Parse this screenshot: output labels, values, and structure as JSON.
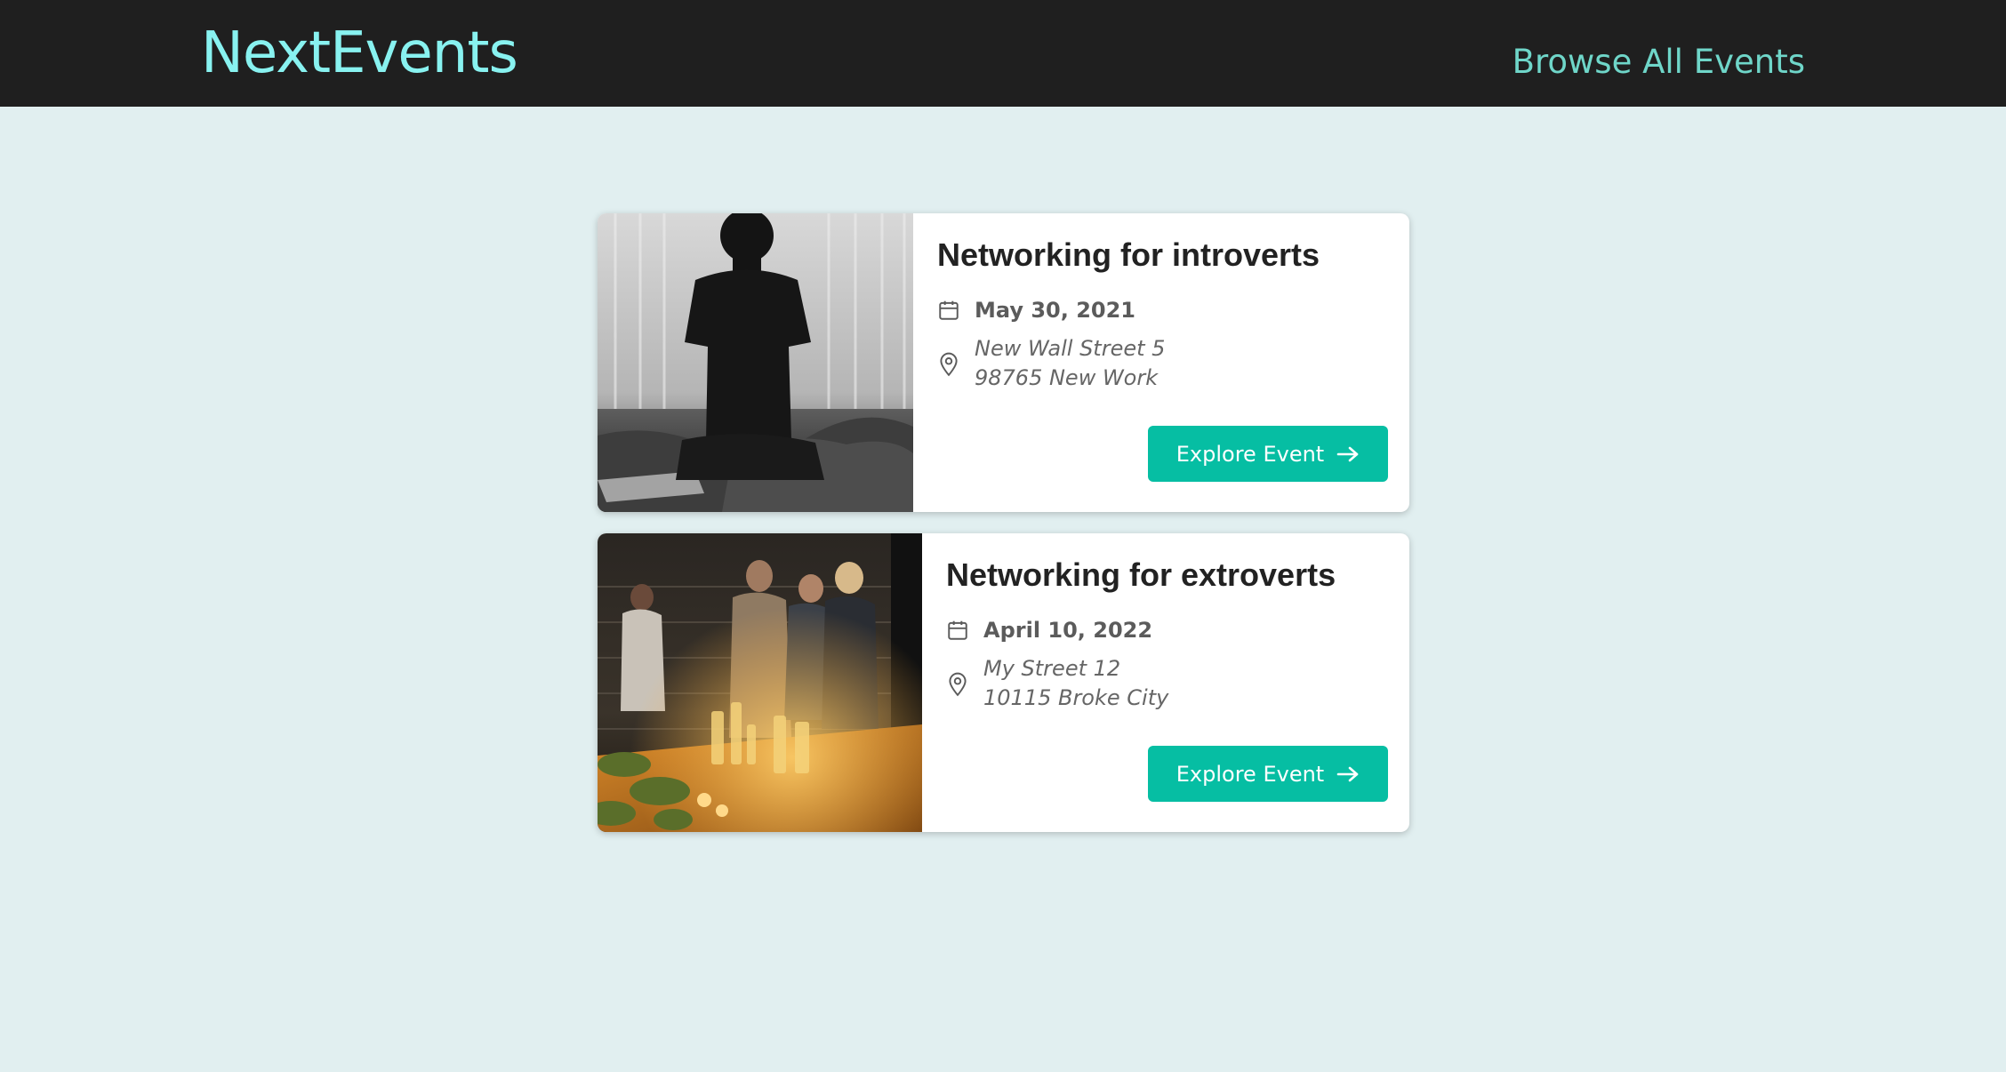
{
  "header": {
    "logo": "NextEvents",
    "nav_link": "Browse All Events"
  },
  "events": [
    {
      "title": "Networking for introverts",
      "date": "May 30, 2021",
      "address_line1": "New Wall Street 5",
      "address_line2": "98765 New Work",
      "button_label": "Explore Event",
      "image": "person-silhouette-photo"
    },
    {
      "title": "Networking for extroverts",
      "date": "April 10, 2022",
      "address_line1": "My Street 12",
      "address_line2": "10115 Broke City",
      "button_label": "Explore Event",
      "image": "party-people-photo"
    }
  ],
  "colors": {
    "header_bg": "#1f1f1f",
    "logo": "#88f2f0",
    "nav_link": "#6fd6c9",
    "page_bg": "#e1eff0",
    "button_bg": "#06bea3"
  },
  "icons": [
    "calendar-icon",
    "location-pin-icon",
    "arrow-right-icon"
  ]
}
